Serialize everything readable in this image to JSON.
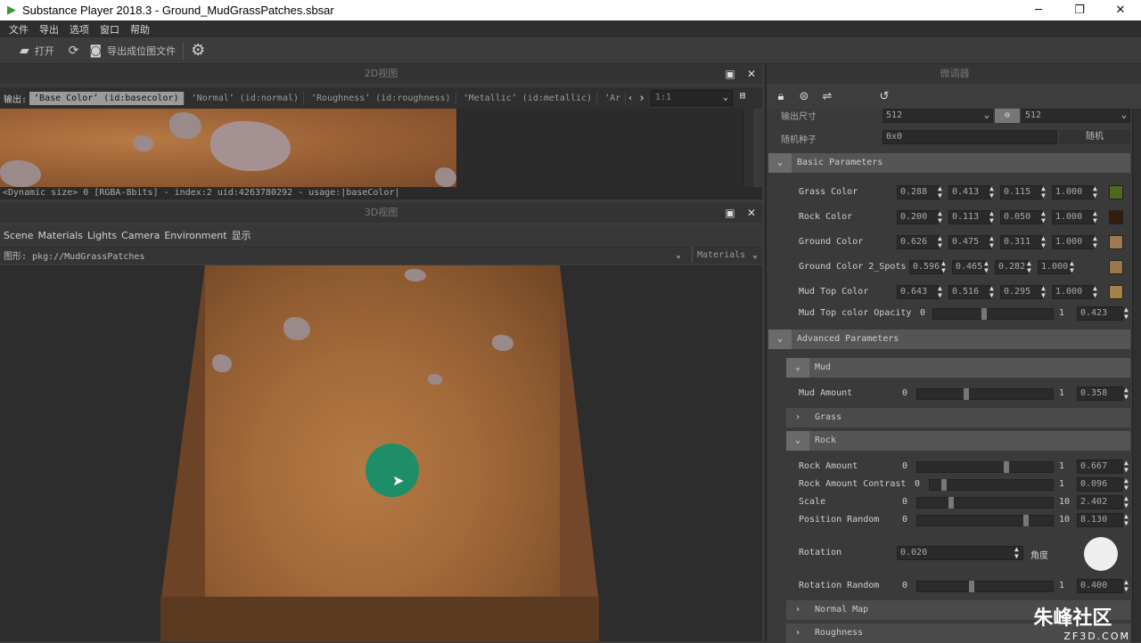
{
  "window": {
    "title": "Substance Player 2018.3 - Ground_MudGrassPatches.sbsar",
    "logo": "play-triangle-icon",
    "minimize": "─",
    "maximize": "❐",
    "close": "✕"
  },
  "menu": [
    "文件",
    "导出",
    "选项",
    "窗口",
    "帮助"
  ],
  "toolbar": {
    "open": "打开",
    "export_bitmap": "导出成位图文件"
  },
  "view2d": {
    "title": "2D视图",
    "output_label": "输出:",
    "outputs": [
      "‘Base Color’ (id:basecolor)",
      "‘Normal’ (id:normal)",
      "‘Roughness’ (id:roughness)",
      "‘Metallic’ (id:metallic)",
      "‘Ar"
    ],
    "zoom": "1:1",
    "status": "<Dynamic size> 0 [RGBA-8bits] - index:2 uid:4263780292 - usage:|baseColor|"
  },
  "view3d": {
    "title": "3D视图",
    "menu": [
      "Scene",
      "Materials",
      "Lights",
      "Camera",
      "Environment",
      "显示"
    ],
    "geometry_label": "图形: pkg://MudGrassPatches",
    "materials_dropdown": "Materials"
  },
  "panel": {
    "title": "微调器",
    "output_size_label": "输出尺寸",
    "output_w": "512",
    "output_h": "512",
    "seed_label": "随机种子",
    "seed_value": "0x0",
    "random_button": "随机",
    "basic_section": "Basic Parameters",
    "colors": [
      {
        "label": "Grass Color",
        "r": "0.288",
        "g": "0.413",
        "b": "0.115",
        "a": "1.000",
        "swatch": "#4a6a1d"
      },
      {
        "label": "Rock Color",
        "r": "0.200",
        "g": "0.113",
        "b": "0.050",
        "a": "1.000",
        "swatch": "#331d0d"
      },
      {
        "label": "Ground Color",
        "r": "0.626",
        "g": "0.475",
        "b": "0.311",
        "a": "1.000",
        "swatch": "#a07950"
      },
      {
        "label": "Ground Color 2_Spots",
        "r": "0.596",
        "g": "0.465",
        "b": "0.282",
        "a": "1.000",
        "swatch": "#987748"
      },
      {
        "label": "Mud Top Color",
        "r": "0.643",
        "g": "0.516",
        "b": "0.295",
        "a": "1.000",
        "swatch": "#a4834b"
      }
    ],
    "mud_top_opacity": {
      "label": "Mud Top color Opacity",
      "min": "0",
      "max": "1",
      "value": "0.423",
      "fraction": 0.423
    },
    "advanced_section": "Advanced Parameters",
    "mud_section": "Mud",
    "mud_amount": {
      "label": "Mud Amount",
      "min": "0",
      "max": "1",
      "value": "0.358",
      "fraction": 0.358
    },
    "grass_section": "Grass",
    "rock_section": "Rock",
    "rock_params": [
      {
        "label": "Rock Amount",
        "min": "0",
        "max": "1",
        "value": "0.667",
        "fraction": 0.667
      },
      {
        "label": "Rock Amount Contrast",
        "min": "0",
        "max": "1",
        "value": "0.096",
        "fraction": 0.096
      },
      {
        "label": "Scale",
        "min": "0",
        "max": "10",
        "value": "2.402",
        "fraction": 0.2402
      },
      {
        "label": "Position Random",
        "min": "0",
        "max": "10",
        "value": "8.130",
        "fraction": 0.813
      }
    ],
    "rotation": {
      "label": "Rotation",
      "value": "0.020",
      "unit": "角度"
    },
    "rotation_random": {
      "label": "Rotation Random",
      "min": "0",
      "max": "1",
      "value": "0.400",
      "fraction": 0.4
    },
    "normal_map_section": "Normal Map",
    "roughness_section": "Roughness"
  },
  "watermark": {
    "text": "朱峰社区",
    "sub": "ZF3D.COM"
  }
}
